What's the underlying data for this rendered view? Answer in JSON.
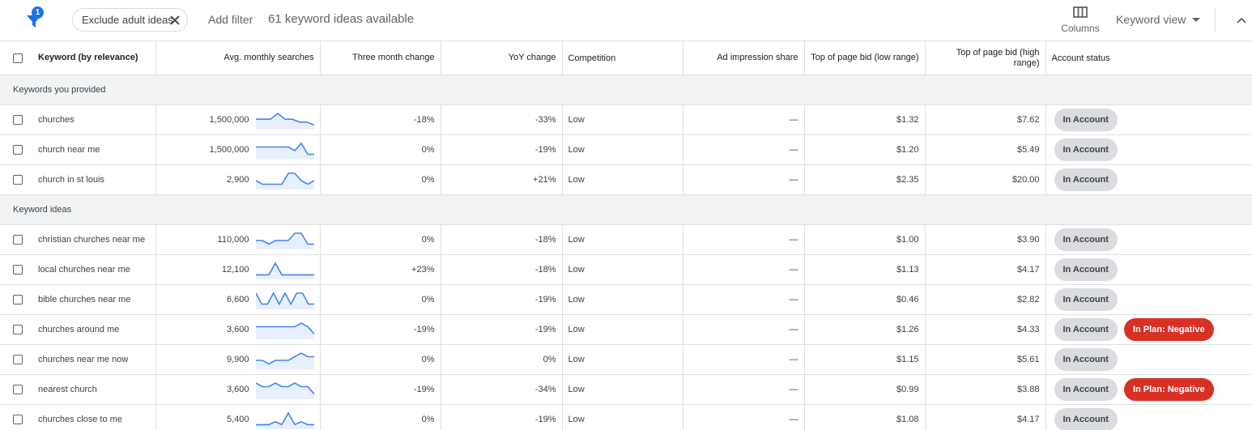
{
  "toolbar": {
    "filter_badge": "1",
    "chip_label": "Exclude adult ideas",
    "add_filter": "Add filter",
    "ideas_count": "61 keyword ideas available",
    "columns_label": "Columns",
    "view_label": "Keyword view"
  },
  "table": {
    "headers": {
      "keyword": "Keyword (by relevance)",
      "avg_searches": "Avg. monthly searches",
      "three_month": "Three month change",
      "yoy": "YoY change",
      "competition": "Competition",
      "ad_impression": "Ad impression share",
      "bid_low": "Top of page bid (low range)",
      "bid_high": "Top of page bid (high range)",
      "status": "Account status"
    },
    "groups": [
      {
        "label": "Keywords you provided",
        "rows": [
          {
            "keyword": "churches",
            "searches": "1,500,000",
            "trend": [
              3,
              3,
              3,
              5,
              3,
              3,
              2,
              2,
              1
            ],
            "three_month": "-18%",
            "yoy": "-33%",
            "competition": "Low",
            "impression": "—",
            "bid_low": "$1.32",
            "bid_high": "$7.62",
            "status": "In Account",
            "plan": ""
          },
          {
            "keyword": "church near me",
            "searches": "1,500,000",
            "trend": [
              3,
              3,
              3,
              3,
              3,
              3,
              2,
              4,
              1,
              1
            ],
            "three_month": "0%",
            "yoy": "-19%",
            "competition": "Low",
            "impression": "—",
            "bid_low": "$1.20",
            "bid_high": "$5.49",
            "status": "In Account",
            "plan": ""
          },
          {
            "keyword": "church in st louis",
            "searches": "2,900",
            "trend": [
              2,
              1,
              1,
              1,
              1,
              4,
              4,
              2,
              1,
              2
            ],
            "three_month": "0%",
            "yoy": "+21%",
            "competition": "Low",
            "impression": "—",
            "bid_low": "$2.35",
            "bid_high": "$20.00",
            "status": "In Account",
            "plan": ""
          }
        ]
      },
      {
        "label": "Keyword ideas",
        "rows": [
          {
            "keyword": "christian churches near me",
            "searches": "110,000",
            "trend": [
              2,
              2,
              1,
              2,
              2,
              2,
              4,
              4,
              1,
              1
            ],
            "three_month": "0%",
            "yoy": "-18%",
            "competition": "Low",
            "impression": "—",
            "bid_low": "$1.00",
            "bid_high": "$3.90",
            "status": "In Account",
            "plan": ""
          },
          {
            "keyword": "local churches near me",
            "searches": "12,100",
            "trend": [
              1,
              1,
              1,
              5,
              1,
              1,
              1,
              1,
              1,
              1
            ],
            "three_month": "+23%",
            "yoy": "-18%",
            "competition": "Low",
            "impression": "—",
            "bid_low": "$1.13",
            "bid_high": "$4.17",
            "status": "In Account",
            "plan": ""
          },
          {
            "keyword": "bible churches near me",
            "searches": "6,600",
            "trend": [
              4,
              1,
              1,
              4,
              1,
              4,
              1,
              4,
              4,
              1,
              1
            ],
            "three_month": "0%",
            "yoy": "-19%",
            "competition": "Low",
            "impression": "—",
            "bid_low": "$0.46",
            "bid_high": "$2.82",
            "status": "In Account",
            "plan": ""
          },
          {
            "keyword": "churches around me",
            "searches": "3,600",
            "trend": [
              3,
              3,
              3,
              3,
              3,
              3,
              3,
              4,
              3,
              1
            ],
            "three_month": "-19%",
            "yoy": "-19%",
            "competition": "Low",
            "impression": "—",
            "bid_low": "$1.26",
            "bid_high": "$4.33",
            "status": "In Account",
            "plan": "In Plan: Negative"
          },
          {
            "keyword": "churches near me now",
            "searches": "9,900",
            "trend": [
              2,
              2,
              1,
              2,
              2,
              2,
              3,
              4,
              3,
              3
            ],
            "three_month": "0%",
            "yoy": "0%",
            "competition": "Low",
            "impression": "—",
            "bid_low": "$1.15",
            "bid_high": "$5.61",
            "status": "In Account",
            "plan": ""
          },
          {
            "keyword": "nearest church",
            "searches": "3,600",
            "trend": [
              4,
              3,
              3,
              4,
              3,
              3,
              4,
              3,
              3,
              1
            ],
            "three_month": "-19%",
            "yoy": "-34%",
            "competition": "Low",
            "impression": "—",
            "bid_low": "$0.99",
            "bid_high": "$3.88",
            "status": "In Account",
            "plan": "In Plan: Negative"
          },
          {
            "keyword": "churches close to me",
            "searches": "5,400",
            "trend": [
              1,
              1,
              1,
              2,
              1,
              5,
              1,
              2,
              1,
              1
            ],
            "three_month": "0%",
            "yoy": "-19%",
            "competition": "Low",
            "impression": "—",
            "bid_low": "$1.08",
            "bid_high": "$4.17",
            "status": "In Account",
            "plan": ""
          }
        ]
      }
    ]
  },
  "icons": {
    "filter": "filter-icon",
    "close": "close-icon",
    "columns": "columns-icon",
    "caret": "caret-down-icon",
    "collapse": "chevron-up-icon"
  },
  "colors": {
    "accent": "#1a73e8",
    "trend_line": "#4285f4",
    "trend_fill": "#e8f0fe",
    "in_account_bg": "#dadce0",
    "in_plan_bg": "#d93025",
    "group_bg": "#f1f3f4"
  }
}
